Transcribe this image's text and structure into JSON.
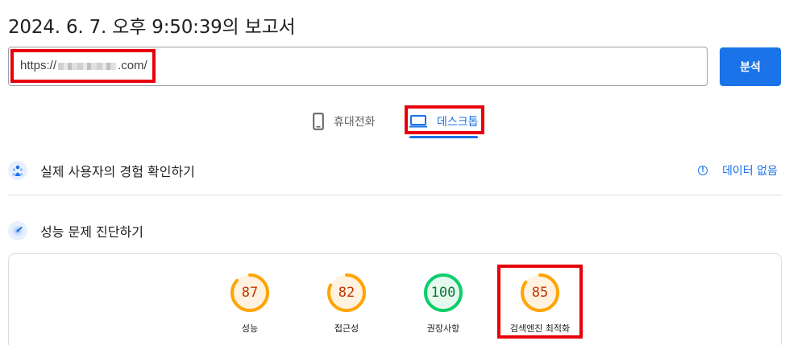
{
  "report": {
    "title": "2024. 6. 7. 오후 9:50:39의 보고서"
  },
  "url_input": {
    "prefix": "https://",
    "suffix": ".com/"
  },
  "analyze_button": {
    "label": "분석"
  },
  "tabs": [
    {
      "label": "휴대전화",
      "icon": "smartphone-icon",
      "selected": false
    },
    {
      "label": "데스크톱",
      "icon": "laptop-icon",
      "selected": true
    }
  ],
  "field_data": {
    "title": "실제 사용자의 경험 확인하기",
    "icon": "users-icon",
    "status": "데이터 없음",
    "status_icon": "info-icon"
  },
  "lab_data": {
    "title": "성능 문제 진단하기",
    "icon": "diagnostics-icon"
  },
  "scores": [
    {
      "label": "성능",
      "value": 87,
      "rating": "average",
      "color": "#ffa400"
    },
    {
      "label": "접근성",
      "value": 82,
      "rating": "average",
      "color": "#ffa400"
    },
    {
      "label": "권장사항",
      "value": 100,
      "rating": "good",
      "color": "#0cce6b"
    },
    {
      "label": "검색엔진 최적화",
      "value": 85,
      "rating": "average",
      "color": "#ffa400"
    }
  ],
  "colors": {
    "accent": "#1a73e8",
    "highlight_box": "#e8000b",
    "average": "#ffa400",
    "good": "#0cce6b"
  }
}
